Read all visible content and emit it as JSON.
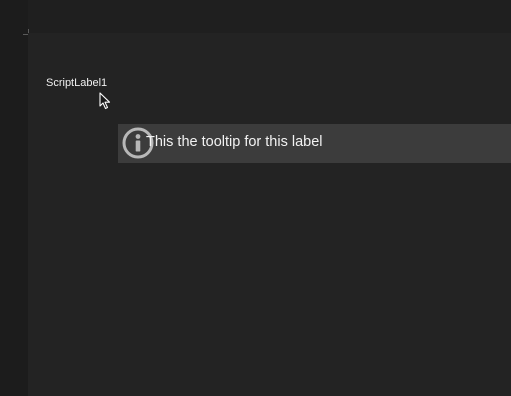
{
  "label": {
    "text": "ScriptLabel1"
  },
  "tooltip": {
    "text": "This the tooltip for this label",
    "icon": "info-icon"
  },
  "colors": {
    "canvas_background": "#232323",
    "tooltip_background": "#3c3c3c",
    "text": "#f0f0f0"
  }
}
